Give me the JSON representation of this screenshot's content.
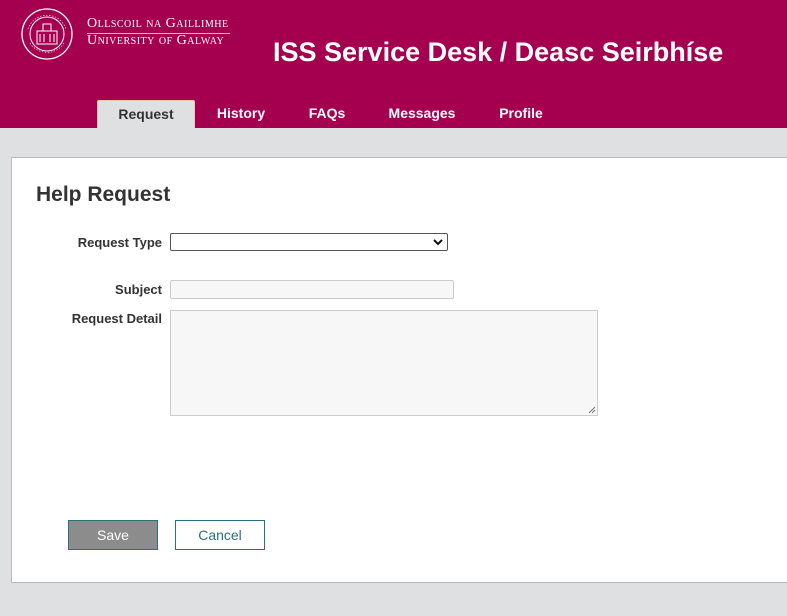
{
  "brand": {
    "line1": "Ollscoil na Gaillimhe",
    "line2": "University of Galway",
    "seal_text": "GAILLIMH GALWAY"
  },
  "header": {
    "title": "ISS Service Desk / Deasc Seirbhíse"
  },
  "tabs": [
    {
      "label": "Request",
      "active": true
    },
    {
      "label": "History",
      "active": false
    },
    {
      "label": "FAQs",
      "active": false
    },
    {
      "label": "Messages",
      "active": false
    },
    {
      "label": "Profile",
      "active": false
    }
  ],
  "form": {
    "title": "Help Request",
    "request_type_label": "Request Type",
    "request_type_value": "",
    "subject_label": "Subject",
    "subject_value": "",
    "detail_label": "Request Detail",
    "detail_value": ""
  },
  "actions": {
    "save_label": "Save",
    "cancel_label": "Cancel"
  },
  "colors": {
    "brand": "#a50050",
    "page_bg": "#dfe0e1",
    "button_teal": "#2a6f7f"
  },
  "icons": {
    "seal": "university-seal-icon",
    "dropdown": "chevron-down-icon",
    "resize": "resize-grip-icon"
  }
}
